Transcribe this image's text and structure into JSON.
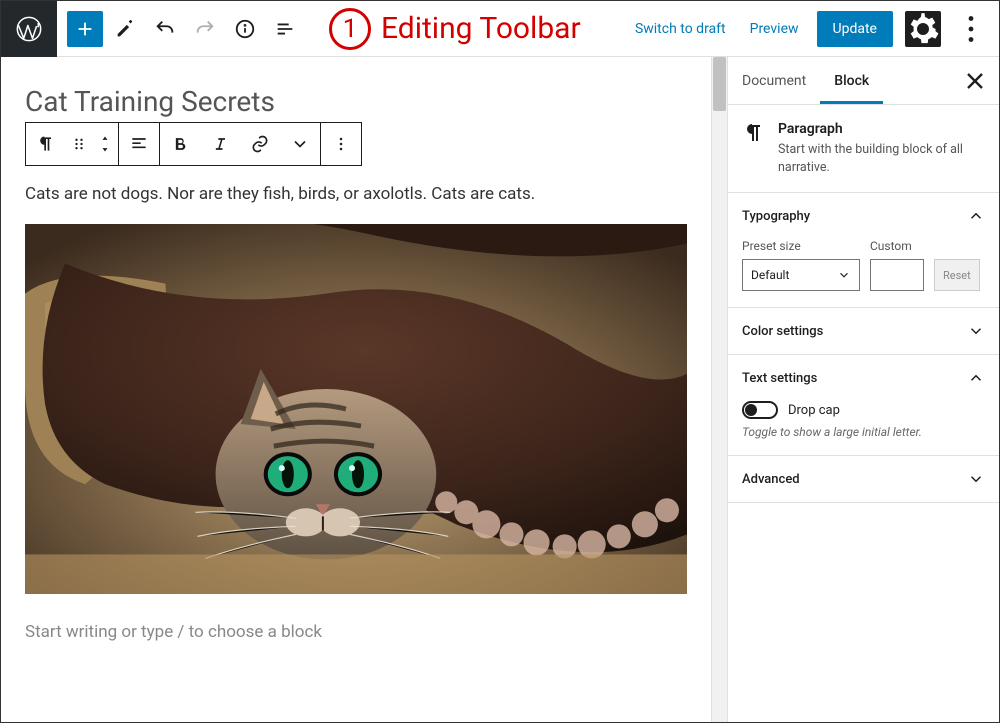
{
  "annotation": {
    "number": "1",
    "label": "Editing Toolbar"
  },
  "topbar": {
    "switch_draft": "Switch to draft",
    "preview": "Preview",
    "update": "Update"
  },
  "post": {
    "title": "Cat Training Secrets",
    "paragraph": "Cats are not dogs. Nor are they fish, birds, or axolotls. Cats are cats.",
    "placeholder": "Start writing or type / to choose a block"
  },
  "sidebar": {
    "tabs": {
      "document": "Document",
      "block": "Block"
    },
    "block_info": {
      "title": "Paragraph",
      "desc": "Start with the building block of all narrative."
    },
    "typography": {
      "heading": "Typography",
      "preset_label": "Preset size",
      "preset_value": "Default",
      "custom_label": "Custom",
      "reset": "Reset"
    },
    "color": {
      "heading": "Color settings"
    },
    "text_settings": {
      "heading": "Text settings",
      "dropcap_label": "Drop cap",
      "dropcap_help": "Toggle to show a large initial letter."
    },
    "advanced": {
      "heading": "Advanced"
    }
  }
}
